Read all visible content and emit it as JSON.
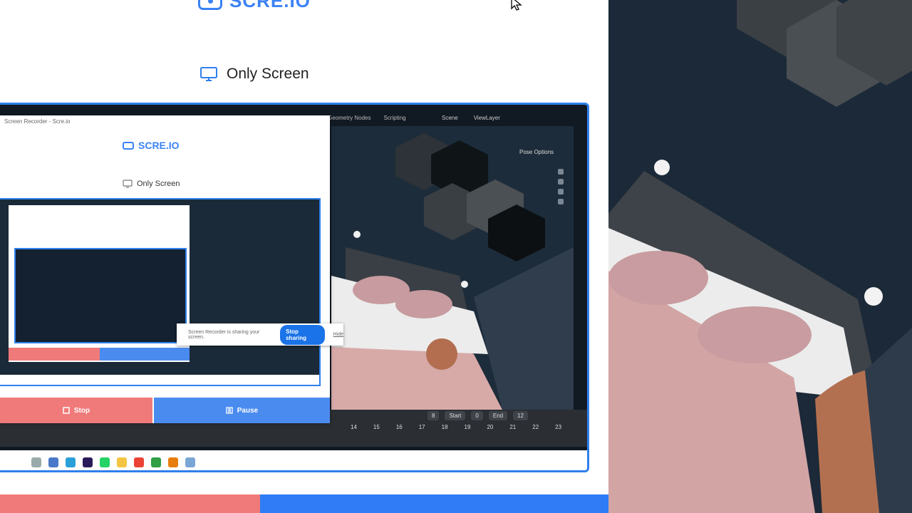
{
  "app": {
    "brand": "SCRE.IO",
    "mode": "Only Screen"
  },
  "nested": {
    "window_title": "Screen Recorder - Scre.io",
    "brand": "SCRE.IO",
    "mode": "Only Screen",
    "stop_label": "Stop",
    "pause_label": "Pause"
  },
  "blender": {
    "tabs": [
      "Geometry Nodes",
      "Scripting"
    ],
    "scene": "Scene",
    "view_layer": "ViewLayer",
    "pose_options": "Pose Options",
    "current_frame": "8",
    "start_label": "Start",
    "start_value": "0",
    "end_label": "End",
    "end_value": "12",
    "frame_numbers": [
      "14",
      "15",
      "16",
      "17",
      "18",
      "19",
      "20",
      "21",
      "22",
      "23"
    ]
  },
  "sharing_bar": {
    "text": "Screen Recorder is sharing your screen.",
    "stop_button": "Stop sharing",
    "hide_link": "Hide"
  },
  "colors": {
    "accent": "#2f80ed",
    "stop": "#f07a7a",
    "pause": "#4a8bf0"
  },
  "icons": [
    "screen-record-icon",
    "monitor-icon",
    "stop-icon",
    "pause-icon",
    "mouse-cursor-icon"
  ]
}
